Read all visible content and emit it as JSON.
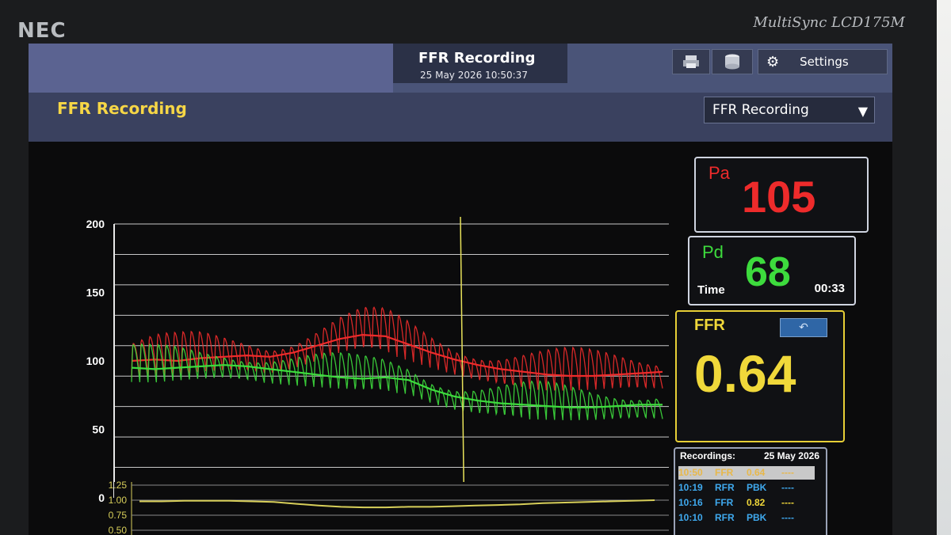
{
  "monitor": {
    "brand": "NEC",
    "model": "MultiSync LCD175M"
  },
  "topbar": {
    "title": "FFR Recording",
    "datetime": "25 May 2026 10:50:37",
    "settings_label": "Settings",
    "icons": [
      "printer-icon",
      "database-icon",
      "gear-icon"
    ]
  },
  "header": {
    "title": "FFR Recording",
    "mode_select": {
      "selected": "FFR Recording"
    }
  },
  "readouts": {
    "pa": {
      "label": "Pa",
      "value": "105",
      "color": "#ee2b2b"
    },
    "pd": {
      "label": "Pd",
      "value": "68",
      "color": "#3ddb3d"
    },
    "time": {
      "label": "Time",
      "value": "00:33"
    },
    "ffr": {
      "label": "FFR",
      "value": "0.64",
      "color": "#f0d83a"
    }
  },
  "recordings": {
    "title": "Recordings:",
    "date": "25 May 2026",
    "rows": [
      {
        "time": "10:50",
        "type": "FFR",
        "value": "0.64",
        "extra": "----",
        "selected": true
      },
      {
        "time": "10:19",
        "type": "RFR",
        "value": "PBK",
        "extra": "----",
        "selected": false
      },
      {
        "time": "10:16",
        "type": "FFR",
        "value": "0.82",
        "extra": "----",
        "selected": false
      },
      {
        "time": "10:10",
        "type": "RFR",
        "value": "PBK",
        "extra": "----",
        "selected": false
      }
    ]
  },
  "chart_data": {
    "type": "line",
    "pressure_axis": {
      "ticks": [
        "200",
        "150",
        "100",
        "50",
        "0"
      ],
      "ylim": [
        0,
        200
      ]
    },
    "series": [
      {
        "color": "#ee2b2b",
        "mean": [
          100,
          101,
          100,
          102,
          103,
          104,
          103,
          106,
          111,
          116,
          119,
          118,
          112,
          106,
          101,
          97,
          94,
          92,
          90,
          89,
          89,
          90,
          91,
          92
        ]
      },
      {
        "color": "#3ddb3d",
        "mean": [
          95,
          94,
          95,
          96,
          97,
          96,
          94,
          92,
          90,
          88,
          87,
          88,
          86,
          79,
          74,
          71,
          69,
          68,
          67,
          66,
          66,
          67,
          68,
          68
        ]
      }
    ],
    "ffr_axis": {
      "ticks": [
        "1.25",
        "1.00",
        "0.75",
        "0.50"
      ]
    },
    "ffr_trace": {
      "color": "#d8cf5a",
      "values": [
        0.98,
        0.98,
        0.99,
        0.99,
        0.99,
        0.98,
        0.97,
        0.94,
        0.91,
        0.89,
        0.88,
        0.88,
        0.89,
        0.89,
        0.9,
        0.91,
        0.92,
        0.93,
        0.95,
        0.96,
        0.97,
        0.98,
        0.99,
        1.0
      ]
    },
    "cursor_color": "#e8e25a"
  }
}
